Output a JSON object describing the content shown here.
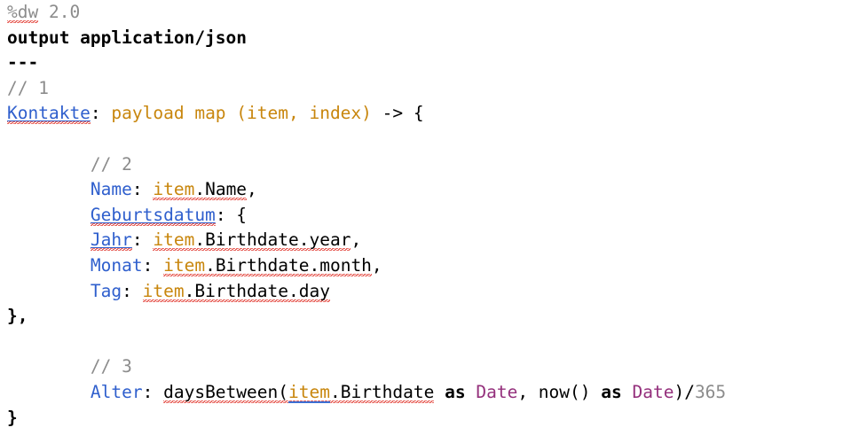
{
  "editor": {
    "language": "DataWeave",
    "background_color": "#ffffff",
    "font_size_px": 19.5,
    "line_height_px": 28.6,
    "colors": {
      "plain": "#000000",
      "comment_gray": "#8c8c8c",
      "key_blue": "#2f5fcd",
      "variable_orange": "#c8860d",
      "type_purple": "#94307c",
      "error_squiggle_red": "#e23a30",
      "number_gray": "#8c8c8c"
    }
  },
  "code": {
    "line_01": {
      "directive": "%dw",
      "version": "2.0"
    },
    "line_02": {
      "text": "output application/json"
    },
    "line_03": {
      "text": "---"
    },
    "line_04": {
      "comment": "// 1"
    },
    "line_05": {
      "key": "Kontakte",
      "colon": ": ",
      "expr": "payload map (item, index)",
      "tail": " -> {"
    },
    "line_07": {
      "comment": "// 2"
    },
    "line_08": {
      "key": "Name",
      "colon": ": ",
      "var": "item",
      "path": ".Name",
      "tail": ","
    },
    "line_09": {
      "key": "Geburtsdatum",
      "colon": ": ",
      "tail": "{"
    },
    "line_10": {
      "key": "Jahr",
      "colon": ": ",
      "var": "item",
      "path": ".Birthdate.year",
      "tail": ","
    },
    "line_11": {
      "key": "Monat",
      "colon": ": ",
      "var": "item",
      "path": ".Birthdate.month",
      "tail": ","
    },
    "line_12": {
      "key": "Tag",
      "colon": ": ",
      "var": "item",
      "path": ".Birthdate.day",
      "tail": ""
    },
    "line_13": {
      "text": "},"
    },
    "line_15": {
      "comment": "// 3"
    },
    "line_16": {
      "key": "Alter",
      "colon": ": ",
      "fn": "daysBetween(",
      "var1": "item",
      "path1": ".Birthdate",
      "as1": " as ",
      "type1": "Date",
      "sep": ", ",
      "fn2": "now()",
      "as2": " as ",
      "type2": "Date",
      "close": ")",
      "divide": "/",
      "number": "365"
    },
    "line_17": {
      "text": "}"
    }
  }
}
